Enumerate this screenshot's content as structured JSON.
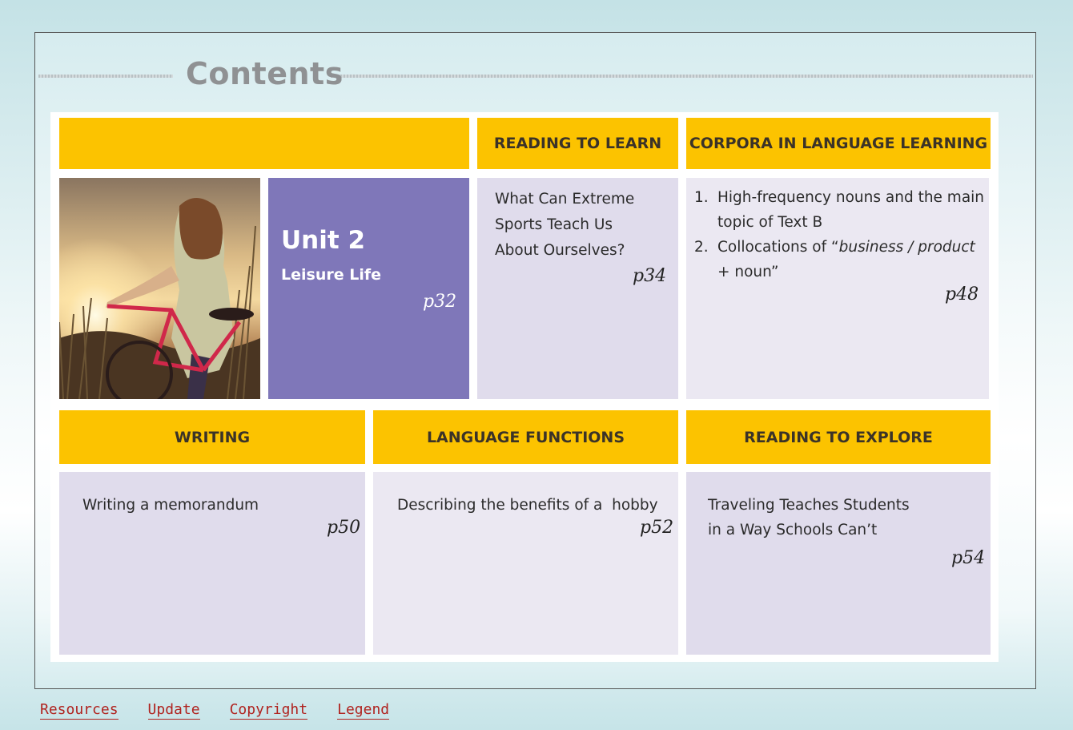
{
  "page_title": "Contents",
  "unit": {
    "title": "Unit 2",
    "subtitle": "Leisure Life",
    "page": "p32"
  },
  "sections": {
    "reading_to_learn": {
      "header": "READING TO LEARN",
      "line1": "What Can Extreme",
      "line2": "Sports Teach Us",
      "line3": "About Ourselves?",
      "page": "p34"
    },
    "corpora": {
      "header": "CORPORA IN LANGUAGE LEARNING",
      "items": [
        {
          "num": "1.",
          "line1": "High-frequency nouns and the main",
          "line2": "topic of Text B"
        },
        {
          "num": "2.",
          "line1_prefix": "Collocations of “",
          "line1_italic": "business / product",
          "line2": "+ noun”"
        }
      ],
      "page": "p48"
    },
    "writing": {
      "header": "WRITING",
      "text": "Writing a memorandum",
      "page": "p50"
    },
    "language_functions": {
      "header": "LANGUAGE FUNCTIONS",
      "text": "Describing the benefits of a  hobby",
      "page": "p52"
    },
    "reading_to_explore": {
      "header": "READING TO EXPLORE",
      "line1": "Traveling Teaches Students",
      "line2": "in a Way Schools Can’t",
      "page": "p54"
    }
  },
  "footer": {
    "links": [
      "Resources",
      "Update",
      "Copyright",
      "Legend"
    ]
  },
  "colors": {
    "header_yellow": "#fcc300",
    "unit_purple": "#7f77b9",
    "content_lavender": "#e0dcec",
    "link_red": "#b0231f"
  }
}
